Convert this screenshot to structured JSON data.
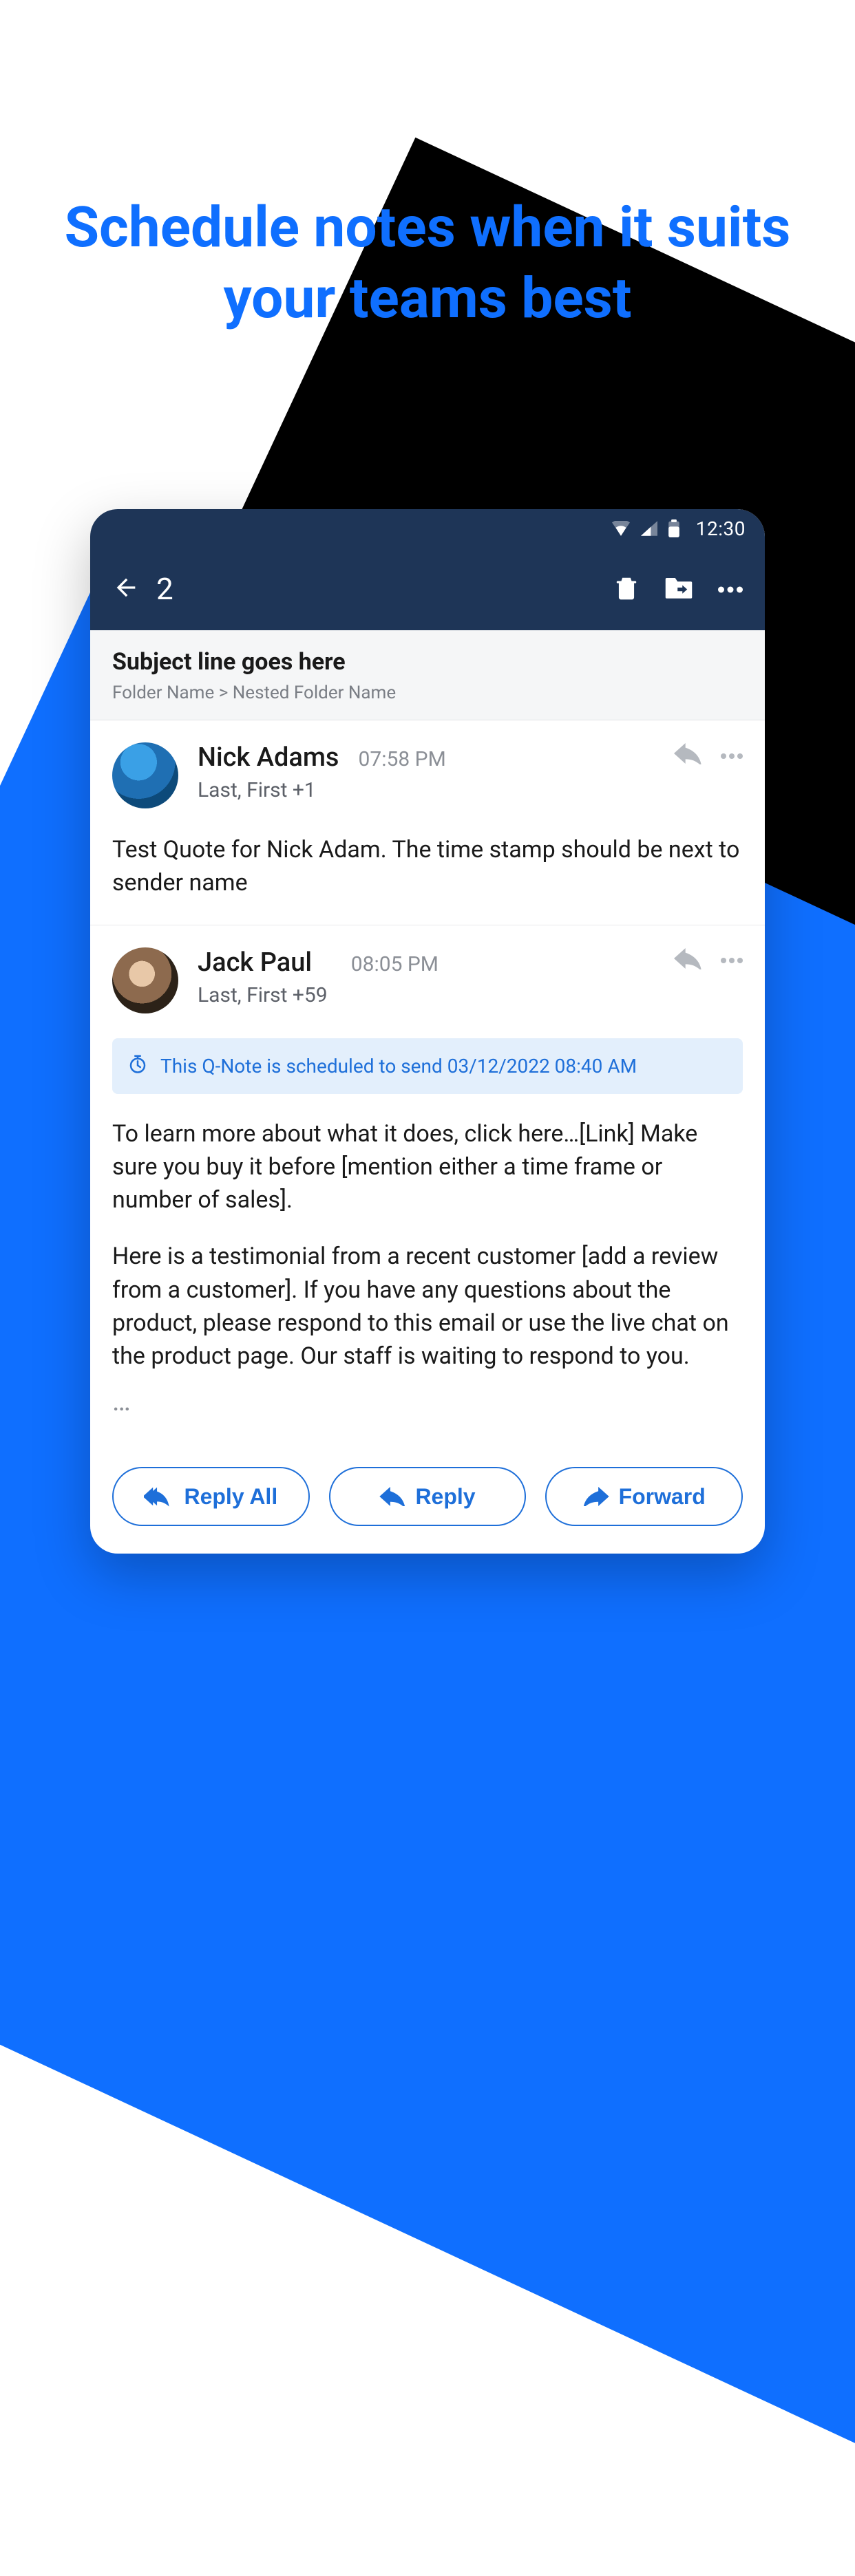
{
  "headline": "Schedule notes when it suits your teams best",
  "statusbar": {
    "time": "12:30"
  },
  "toolbar": {
    "count": "2"
  },
  "subject": {
    "line": "Subject line goes here",
    "breadcrumb": "Folder Name > Nested Folder Name"
  },
  "messages": [
    {
      "sender": "Nick Adams",
      "time": "07:58 PM",
      "recipients": "Last, First  +1",
      "body_p1": "Test Quote for Nick Adam. The time stamp should be next to sender name"
    },
    {
      "sender": "Jack Paul",
      "time": "08:05 PM",
      "recipients": "Last, First  +59",
      "schedule_notice": "This Q-Note is scheduled to send 03/12/2022 08:40 AM",
      "body_p1": "To learn more about what it does, click here…[Link] Make sure you buy it before [mention either a time frame or number of sales].",
      "body_p2": "Here is a testimonial from a recent customer [add a review from a customer]. If you have any questions about the product, please respond to this email or use the live chat on the product page. Our staff is waiting to respond to you.",
      "more": "…"
    }
  ],
  "actions": {
    "reply_all": "Reply All",
    "reply": "Reply",
    "forward": "Forward"
  }
}
